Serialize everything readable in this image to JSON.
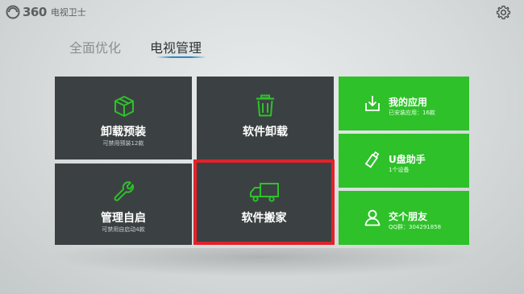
{
  "header": {
    "logo_number": "360",
    "logo_text": "电视卫士",
    "settings_icon": "gear-icon"
  },
  "tabs": [
    {
      "label": "全面优化",
      "active": false
    },
    {
      "label": "电视管理",
      "active": true
    }
  ],
  "tiles": {
    "uninstall_preinstalled": {
      "title": "卸载预装",
      "subtitle": "可禁用预装12款",
      "icon": "box-icon"
    },
    "uninstall_software": {
      "title": "软件卸载",
      "icon": "trash-icon"
    },
    "manage_autostart": {
      "title": "管理自启",
      "subtitle": "可禁用自启动4款",
      "icon": "wrench-icon"
    },
    "move_software": {
      "title": "软件搬家",
      "icon": "truck-icon"
    },
    "my_apps": {
      "title": "我的应用",
      "subtitle": "已安装应用：16款",
      "icon": "download-icon"
    },
    "usb_helper": {
      "title": "U盘助手",
      "subtitle": "1个设备",
      "icon": "usb-drive-icon"
    },
    "make_friends": {
      "title": "交个朋友",
      "subtitle": "QQ群：304291858",
      "icon": "user-icon"
    }
  },
  "colors": {
    "tile_dark": "#3b4142",
    "tile_green": "#2ec12a",
    "icon_green": "#2ec12a",
    "highlight": "#e0232b",
    "tab_underline": "#2a8ac8"
  }
}
